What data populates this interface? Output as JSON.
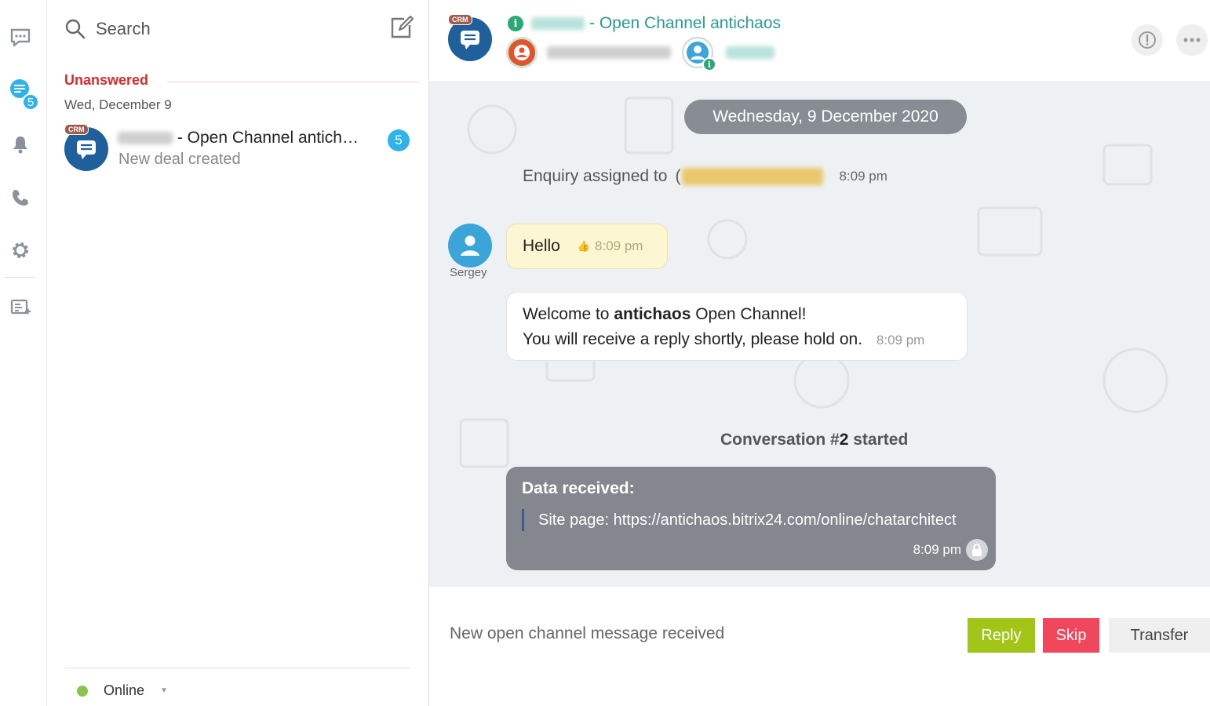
{
  "search": {
    "placeholder": "Search"
  },
  "sidebar": {
    "unread_badge": "5"
  },
  "list": {
    "section_title": "Unanswered",
    "date_label": "Wed, December 9",
    "items": [
      {
        "crm_tag": "CRM",
        "title": "- Open Channel antich…",
        "subtitle": "New deal created",
        "count": "5"
      }
    ],
    "status": "Online"
  },
  "header": {
    "crm_tag": "CRM",
    "title": "- Open Channel antichaos"
  },
  "chat": {
    "date_pill": "Wednesday, 9 December 2020",
    "assigned_text": "Enquiry assigned to",
    "assigned_time": "8:09 pm",
    "author": "Sergey",
    "hello_text": "Hello",
    "hello_time": "8:09 pm",
    "welcome_pre": "Welcome to",
    "welcome_bold": "antichaos",
    "welcome_post": "Open Channel!",
    "welcome_line2": "You will receive a reply shortly, please hold on.",
    "welcome_time": "8:09 pm",
    "conv_pre": "Conversation #",
    "conv_num": "2",
    "conv_post": "started",
    "data_title": "Data received:",
    "data_row": "Site page: https://antichaos.bitrix24.com/online/chatarchitect",
    "data_time": "8:09 pm"
  },
  "footer": {
    "notice": "New open channel message received",
    "reply_label": "Reply",
    "skip_label": "Skip",
    "transfer_label": "Transfer"
  },
  "colors": {
    "accent_blue": "#2fb3e8",
    "crm_navy": "#1f5f9c",
    "unanswered_red": "#d92b2b",
    "reply_green": "#a2c617",
    "skip_red": "#f0475d",
    "channel_teal": "#2a9d8f"
  }
}
